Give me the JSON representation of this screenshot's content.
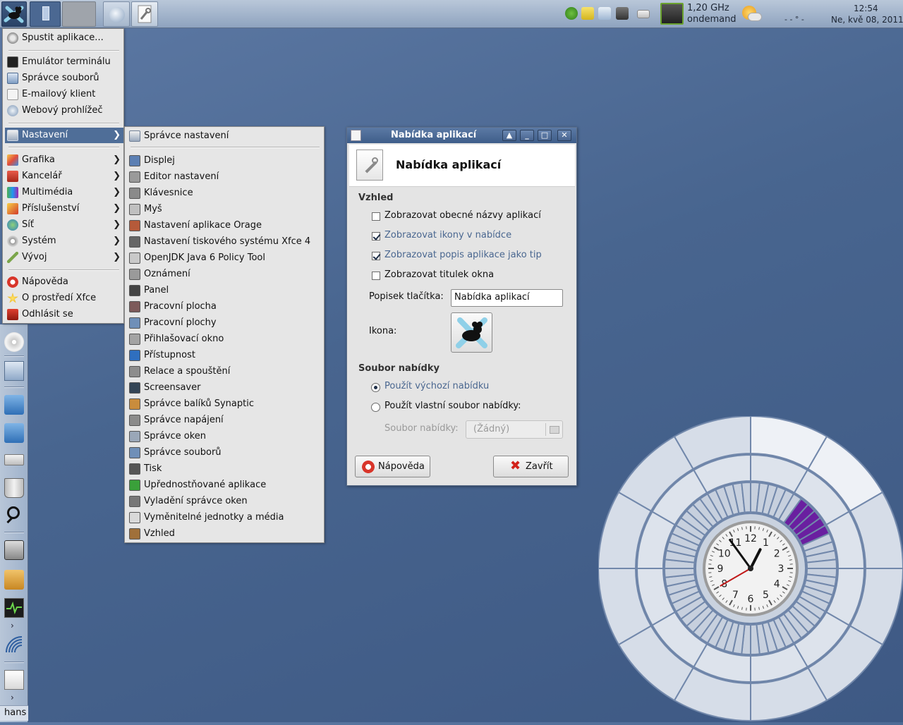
{
  "top_panel": {
    "cpu_freq": "1,20 GHz",
    "cpu_governor": "ondemand",
    "weather_temp": "- - ° -",
    "clock_time": "12:54",
    "clock_date": "Ne, kvě 08, 2011"
  },
  "left_panel": {
    "user": "hans"
  },
  "app_menu": {
    "run": "Spustit aplikace...",
    "favorites": [
      "Emulátor terminálu",
      "Správce souborů",
      "E-mailový klient",
      "Webový prohlížeč"
    ],
    "settings": "Nastavení",
    "categories": [
      "Grafika",
      "Kancelář",
      "Multimédia",
      "Příslušenství",
      "Síť",
      "Systém",
      "Vývoj"
    ],
    "bottom": [
      "Nápověda",
      "O prostředí Xfce",
      "Odhlásit se"
    ]
  },
  "settings_menu": {
    "manager": "Správce nastavení",
    "items": [
      "Displej",
      "Editor nastavení",
      "Klávesnice",
      "Myš",
      "Nastavení aplikace Orage",
      "Nastavení tiskového systému Xfce 4",
      "OpenJDK Java 6 Policy Tool",
      "Oznámení",
      "Panel",
      "Pracovní plocha",
      "Pracovní plochy",
      "Přihlašovací okno",
      "Přístupnost",
      "Relace a spouštění",
      "Screensaver",
      "Správce balíků Synaptic",
      "Správce napájení",
      "Správce oken",
      "Správce souborů",
      "Tisk",
      "Upřednostňované aplikace",
      "Vyladění správce oken",
      "Vyměnitelné jednotky a média",
      "Vzhled"
    ]
  },
  "dialog": {
    "window_title": "Nabídka aplikací",
    "header_title": "Nabídka aplikací",
    "section_appearance": "Vzhled",
    "chk_generic_names": "Zobrazovat obecné názvy aplikací",
    "chk_show_icons": "Zobrazovat ikony v nabídce",
    "chk_tooltips": "Zobrazovat popis aplikace jako tip",
    "chk_window_title": "Zobrazovat titulek okna",
    "button_label_caption": "Popisek tlačítka:",
    "button_label_value": "Nabídka aplikací",
    "icon_caption": "Ikona:",
    "section_menu_file": "Soubor nabídky",
    "radio_default": "Použít výchozí nabídku",
    "radio_custom": "Použít vlastní soubor nabídky:",
    "file_caption": "Soubor nabídky:",
    "file_value": "(Žádný)",
    "help_button": "Nápověda",
    "close_button": "Zavřít"
  },
  "clock_widget": {
    "numbers": [
      "12",
      "1",
      "2",
      "3",
      "4",
      "5",
      "6",
      "7",
      "8",
      "9",
      "10",
      "11"
    ]
  }
}
